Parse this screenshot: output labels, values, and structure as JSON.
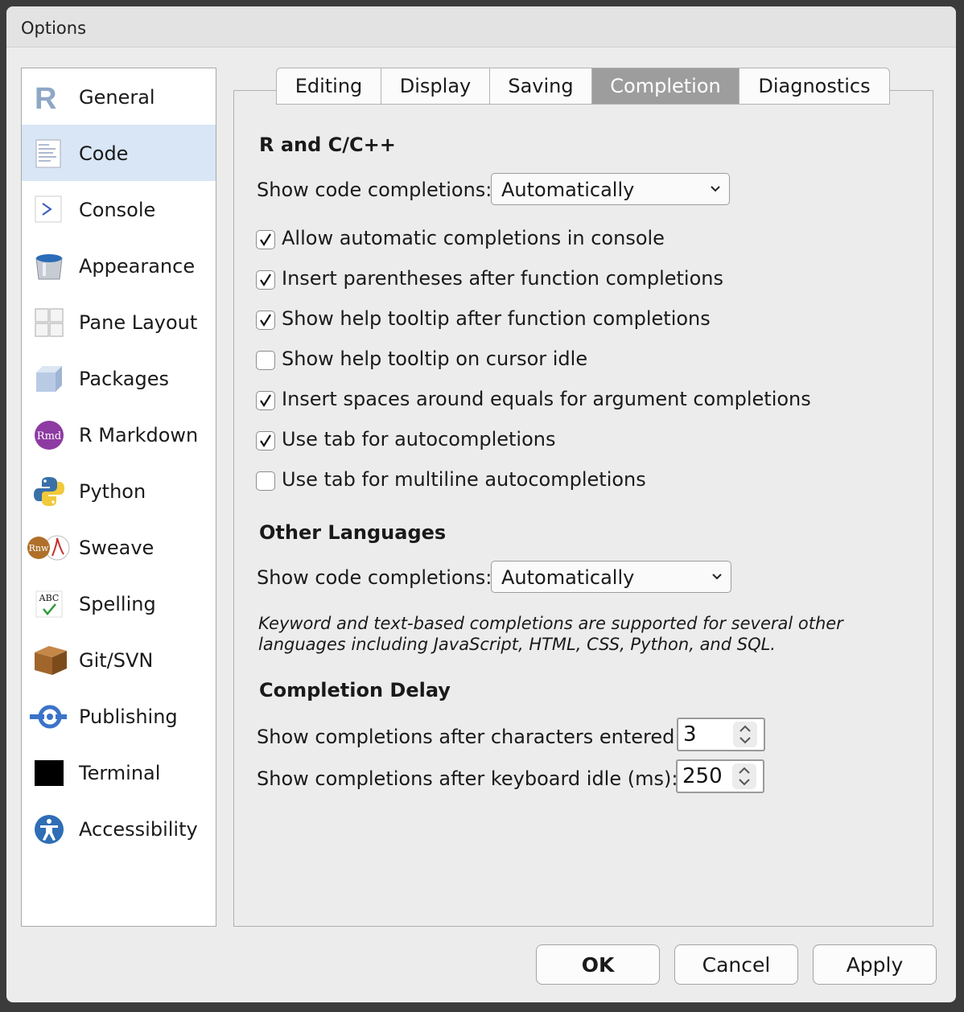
{
  "window": {
    "title": "Options"
  },
  "sidebar": {
    "items": [
      {
        "label": "General",
        "icon": "r-logo-icon"
      },
      {
        "label": "Code",
        "icon": "code-document-icon",
        "selected": true
      },
      {
        "label": "Console",
        "icon": "console-prompt-icon"
      },
      {
        "label": "Appearance",
        "icon": "paint-bucket-icon"
      },
      {
        "label": "Pane Layout",
        "icon": "pane-grid-icon"
      },
      {
        "label": "Packages",
        "icon": "package-cube-icon"
      },
      {
        "label": "R Markdown",
        "icon": "rmd-icon"
      },
      {
        "label": "Python",
        "icon": "python-icon"
      },
      {
        "label": "Sweave",
        "icon": "sweave-icon"
      },
      {
        "label": "Spelling",
        "icon": "spelling-check-icon"
      },
      {
        "label": "Git/SVN",
        "icon": "git-box-icon"
      },
      {
        "label": "Publishing",
        "icon": "publishing-icon"
      },
      {
        "label": "Terminal",
        "icon": "terminal-icon"
      },
      {
        "label": "Accessibility",
        "icon": "accessibility-icon"
      }
    ]
  },
  "tabs": [
    {
      "label": "Editing"
    },
    {
      "label": "Display"
    },
    {
      "label": "Saving"
    },
    {
      "label": "Completion",
      "active": true
    },
    {
      "label": "Diagnostics"
    }
  ],
  "r_section": {
    "title": "R and C/C++",
    "completions_label": "Show code completions:",
    "completions_value": "Automatically",
    "checkboxes": [
      {
        "label": "Allow automatic completions in console",
        "checked": true
      },
      {
        "label": "Insert parentheses after function completions",
        "checked": true
      },
      {
        "label": "Show help tooltip after function completions",
        "checked": true
      },
      {
        "label": "Show help tooltip on cursor idle",
        "checked": false
      },
      {
        "label": "Insert spaces around equals for argument completions",
        "checked": true
      },
      {
        "label": "Use tab for autocompletions",
        "checked": true
      },
      {
        "label": "Use tab for multiline autocompletions",
        "checked": false
      }
    ]
  },
  "other_section": {
    "title": "Other Languages",
    "completions_label": "Show code completions:",
    "completions_value": "Automatically",
    "note_line1": "Keyword and text-based completions are supported for several other",
    "note_line2": "languages including JavaScript, HTML, CSS, Python, and SQL."
  },
  "delay_section": {
    "title": "Completion Delay",
    "chars_label": "Show completions after characters entered:",
    "chars_value": "3",
    "idle_label": "Show completions after keyboard idle (ms):",
    "idle_value": "250"
  },
  "buttons": {
    "ok": "OK",
    "cancel": "Cancel",
    "apply": "Apply"
  },
  "colors": {
    "selected_sidebar": "#d8e6f5",
    "active_tab": "#9d9d9d"
  }
}
